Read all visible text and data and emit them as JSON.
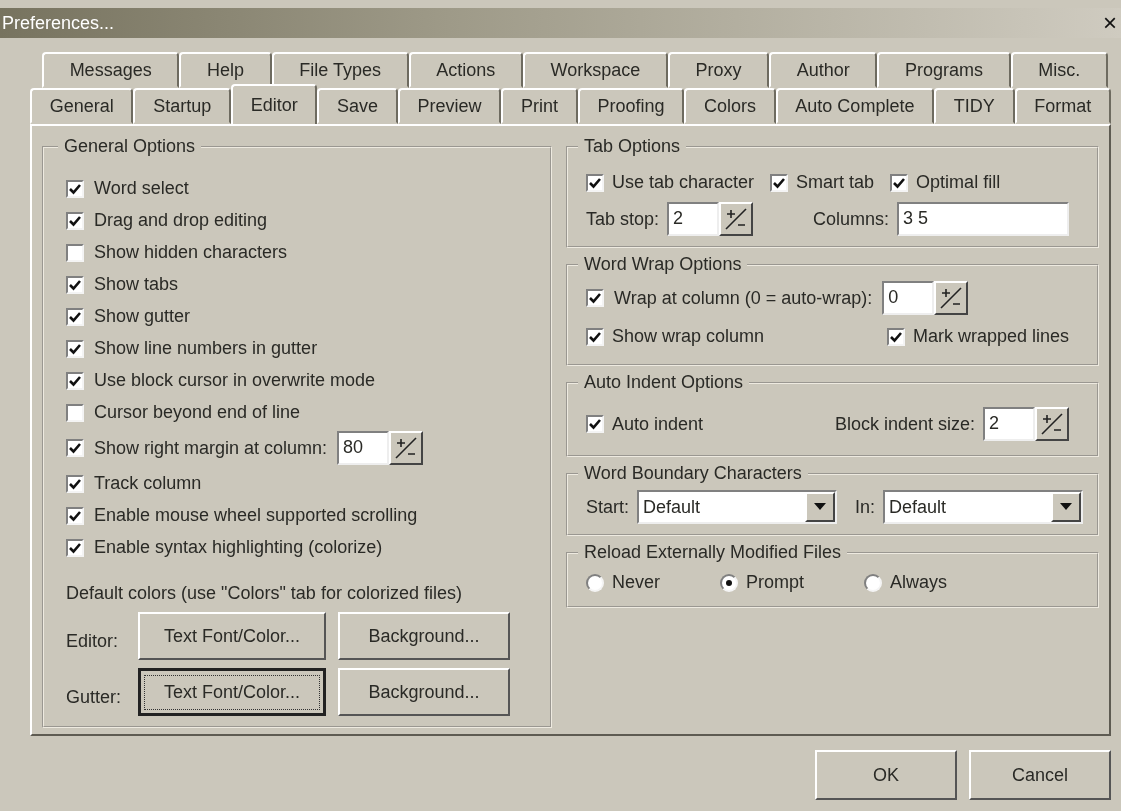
{
  "window": {
    "title": "Preferences...",
    "close": "×"
  },
  "tab_rows": [
    [
      {
        "label": "Messages",
        "selected": false
      },
      {
        "label": "Help",
        "selected": false
      },
      {
        "label": "File Types",
        "selected": false
      },
      {
        "label": "Actions",
        "selected": false
      },
      {
        "label": "Workspace",
        "selected": false
      },
      {
        "label": "Proxy",
        "selected": false
      },
      {
        "label": "Author",
        "selected": false
      },
      {
        "label": "Programs",
        "selected": false
      },
      {
        "label": "Misc.",
        "selected": false
      }
    ],
    [
      {
        "label": "General",
        "selected": false
      },
      {
        "label": "Startup",
        "selected": false
      },
      {
        "label": "Editor",
        "selected": true
      },
      {
        "label": "Save",
        "selected": false
      },
      {
        "label": "Preview",
        "selected": false
      },
      {
        "label": "Print",
        "selected": false
      },
      {
        "label": "Proofing",
        "selected": false
      },
      {
        "label": "Colors",
        "selected": false
      },
      {
        "label": "Auto Complete",
        "selected": false
      },
      {
        "label": "TIDY",
        "selected": false
      },
      {
        "label": "Format",
        "selected": false
      }
    ]
  ],
  "general_options": {
    "title": "General Options",
    "options": [
      {
        "kind": "checkbox",
        "label": "Word select",
        "checked": true
      },
      {
        "kind": "checkbox",
        "label": "Drag and drop editing",
        "checked": true
      },
      {
        "kind": "checkbox",
        "label": "Show hidden characters",
        "checked": false
      },
      {
        "kind": "checkbox",
        "label": "Show tabs",
        "checked": true
      },
      {
        "kind": "checkbox",
        "label": "Show gutter",
        "checked": true
      },
      {
        "kind": "checkbox",
        "label": "Show line numbers in gutter",
        "checked": true
      },
      {
        "kind": "checkbox",
        "label": "Use block cursor in overwrite mode",
        "checked": true
      },
      {
        "kind": "checkbox",
        "label": "Cursor beyond end of line",
        "checked": false
      },
      {
        "kind": "checkbox_spin",
        "label": "Show right margin at column:",
        "checked": true,
        "value": "80"
      },
      {
        "kind": "checkbox",
        "label": "Track column",
        "checked": true
      },
      {
        "kind": "checkbox",
        "label": "Enable mouse wheel supported scrolling",
        "checked": true
      },
      {
        "kind": "checkbox",
        "label": "Enable syntax highlighting (colorize)",
        "checked": true
      }
    ],
    "note": "Default colors (use \"Colors\" tab for colorized files)",
    "color_rows": [
      {
        "label": "Editor:",
        "buttons": [
          {
            "label": "Text Font/Color...",
            "focused": false
          },
          {
            "label": "Background...",
            "focused": false
          }
        ]
      },
      {
        "label": "Gutter:",
        "buttons": [
          {
            "label": "Text Font/Color...",
            "focused": true
          },
          {
            "label": "Background...",
            "focused": false
          }
        ]
      }
    ]
  },
  "tab_options": {
    "title": "Tab Options",
    "options": [
      {
        "label": "Use tab character",
        "checked": true
      },
      {
        "label": "Smart tab",
        "checked": true
      },
      {
        "label": "Optimal fill",
        "checked": true
      }
    ],
    "tab_stop": {
      "label": "Tab stop:",
      "value": "2"
    },
    "columns": {
      "label": "Columns:",
      "value": "3 5"
    }
  },
  "word_wrap_options": {
    "title": "Word Wrap Options",
    "wrap": {
      "label": "Wrap at column (0 = auto-wrap):",
      "checked": true,
      "value": "0"
    },
    "options": [
      {
        "label": "Show wrap column",
        "checked": true
      },
      {
        "label": "Mark wrapped lines",
        "checked": true
      }
    ]
  },
  "auto_indent_options": {
    "title": "Auto Indent Options",
    "auto_indent": {
      "label": "Auto indent",
      "checked": true
    },
    "block_indent": {
      "label": "Block indent size:",
      "value": "2"
    }
  },
  "word_boundary_characters": {
    "title": "Word Boundary Characters",
    "start": {
      "label": "Start:",
      "value": "Default"
    },
    "in": {
      "label": "In:",
      "value": "Default"
    }
  },
  "reload_externally_modified_files": {
    "title": "Reload Externally Modified Files",
    "options": [
      {
        "label": "Never",
        "selected": false
      },
      {
        "label": "Prompt",
        "selected": true
      },
      {
        "label": "Always",
        "selected": false
      }
    ]
  },
  "buttons": [
    {
      "label": "OK"
    },
    {
      "label": "Cancel"
    }
  ]
}
